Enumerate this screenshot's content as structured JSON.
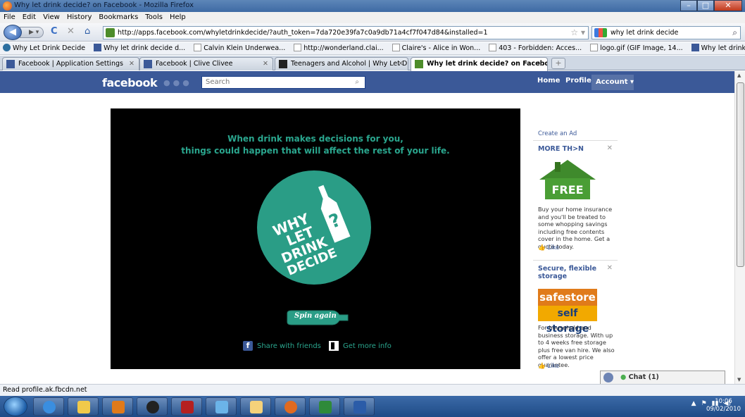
{
  "window": {
    "title": "Why let drink decide? on Facebook - Mozilla Firefox",
    "minimize": "–",
    "maximize": "□",
    "close": "✕"
  },
  "menu": [
    "File",
    "Edit",
    "View",
    "History",
    "Bookmarks",
    "Tools",
    "Help"
  ],
  "nav": {
    "url": "http://apps.facebook.com/whyletdrinkdecide/?auth_token=7da720e39fa7c0a9db71a4cf7f047d84&installed=1",
    "search_value": "why let drink decide"
  },
  "bookmarks": [
    {
      "label": "Why Let Drink Decide",
      "icon": "site-icon"
    },
    {
      "label": "Why let drink decide d...",
      "icon": "facebook-icon"
    },
    {
      "label": "Calvin Klein Underwea...",
      "icon": "page-icon"
    },
    {
      "label": "http://wonderland.clai...",
      "icon": "page-icon"
    },
    {
      "label": "Claire's - Alice in Won...",
      "icon": "page-icon"
    },
    {
      "label": "403 - Forbidden: Acces...",
      "icon": "page-icon"
    },
    {
      "label": "logo.gif (GIF Image, 14...",
      "icon": "page-icon"
    },
    {
      "label": "Why let drink decide d...",
      "icon": "facebook-icon"
    }
  ],
  "tabs": [
    {
      "label": "Facebook | Application Settings",
      "active": false
    },
    {
      "label": "Facebook | Clive Clivee",
      "active": false
    },
    {
      "label": "Teenagers and Alcohol | Why Let Dr...",
      "active": false
    },
    {
      "label": "Why let drink decide? on Facebook",
      "active": true
    }
  ],
  "facebook": {
    "logo": "facebook",
    "search_placeholder": "Search",
    "home": "Home",
    "profile": "Profile",
    "account": "Account ▾"
  },
  "app": {
    "tagline_1": "When drink makes decisions for you,",
    "tagline_2": "things could happen that will affect the rest of your life.",
    "logo_lines": [
      "WHY",
      "LET",
      "DRINK",
      "DECIDE"
    ],
    "spin_label": "Spin again",
    "share_label": "Share with friends",
    "more_info_label": "Get more info"
  },
  "ads": {
    "create": "Create an Ad",
    "ad1": {
      "title": "MORE TH>N",
      "image_text": "FREE",
      "body": "Buy your home insurance and you'll be treated to some whopping savings including free contents cover in the home. Get a quote today.",
      "like": "Like"
    },
    "ad2": {
      "title": "Secure, flexible storage",
      "image_text_1": "safestore",
      "image_text_2": "self storage",
      "body": "For household and business storage. With up to 4 weeks free storage plus free van hire. We also offer a lowest price guarantee.",
      "like": "Like"
    }
  },
  "chat": {
    "label": "Chat (1)"
  },
  "status": "Read profile.ak.fbcdn.net",
  "clock": {
    "time": "10:06",
    "date": "09/02/2010"
  },
  "colors": {
    "facebook_blue": "#3b5998",
    "app_teal": "#2aa68e",
    "app_circle": "#2a9d86"
  }
}
